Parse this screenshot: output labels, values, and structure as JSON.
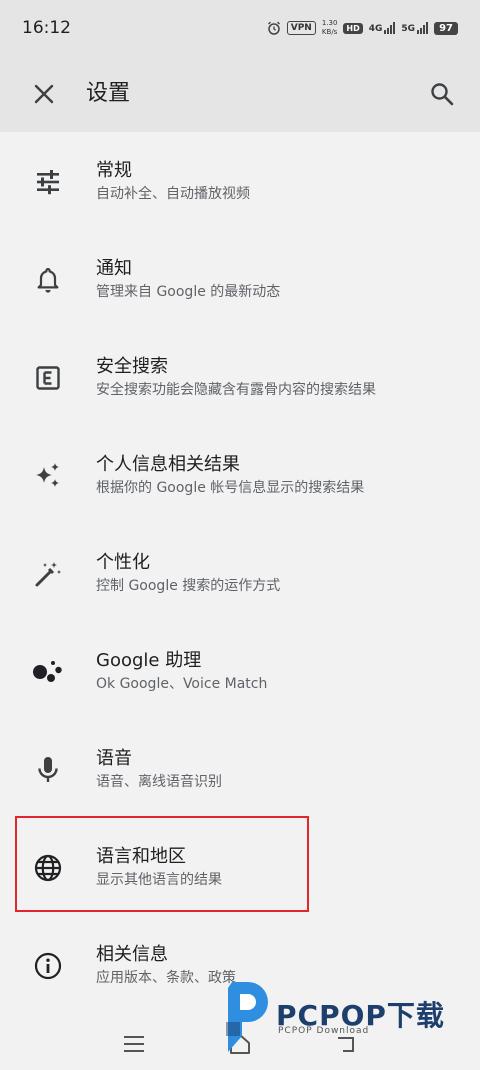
{
  "status": {
    "time": "16:12",
    "vpn": "VPN",
    "speed_value": "1.30",
    "speed_unit": "KB/s",
    "hd": "HD",
    "net1": "4G",
    "net2": "5G",
    "battery": "97"
  },
  "toolbar": {
    "title": "设置"
  },
  "items": [
    {
      "label": "常规",
      "desc": "自动补全、自动播放视频",
      "icon": "tune-icon"
    },
    {
      "label": "通知",
      "desc": "管理来自 Google 的最新动态",
      "icon": "bell-icon"
    },
    {
      "label": "安全搜索",
      "desc": "安全搜索功能会隐藏含有露骨内容的搜索结果",
      "icon": "explicit-icon"
    },
    {
      "label": "个人信息相关结果",
      "desc": "根据你的 Google 帐号信息显示的搜索结果",
      "icon": "sparkle-icon"
    },
    {
      "label": "个性化",
      "desc": "控制 Google 搜索的运作方式",
      "icon": "magic-wand-icon"
    },
    {
      "label": "Google 助理",
      "desc": "Ok Google、Voice Match",
      "icon": "assistant-icon"
    },
    {
      "label": "语音",
      "desc": "语音、离线语音识别",
      "icon": "microphone-icon"
    },
    {
      "label": "语言和地区",
      "desc": "显示其他语言的结果",
      "icon": "globe-icon"
    },
    {
      "label": "相关信息",
      "desc": "应用版本、条款、政策",
      "icon": "info-icon"
    }
  ],
  "watermark": {
    "name": "PCPOP下载",
    "sub": "PCPOP Download"
  },
  "colors": {
    "highlight": "#e3262e",
    "brand": "#1d3f6e"
  }
}
